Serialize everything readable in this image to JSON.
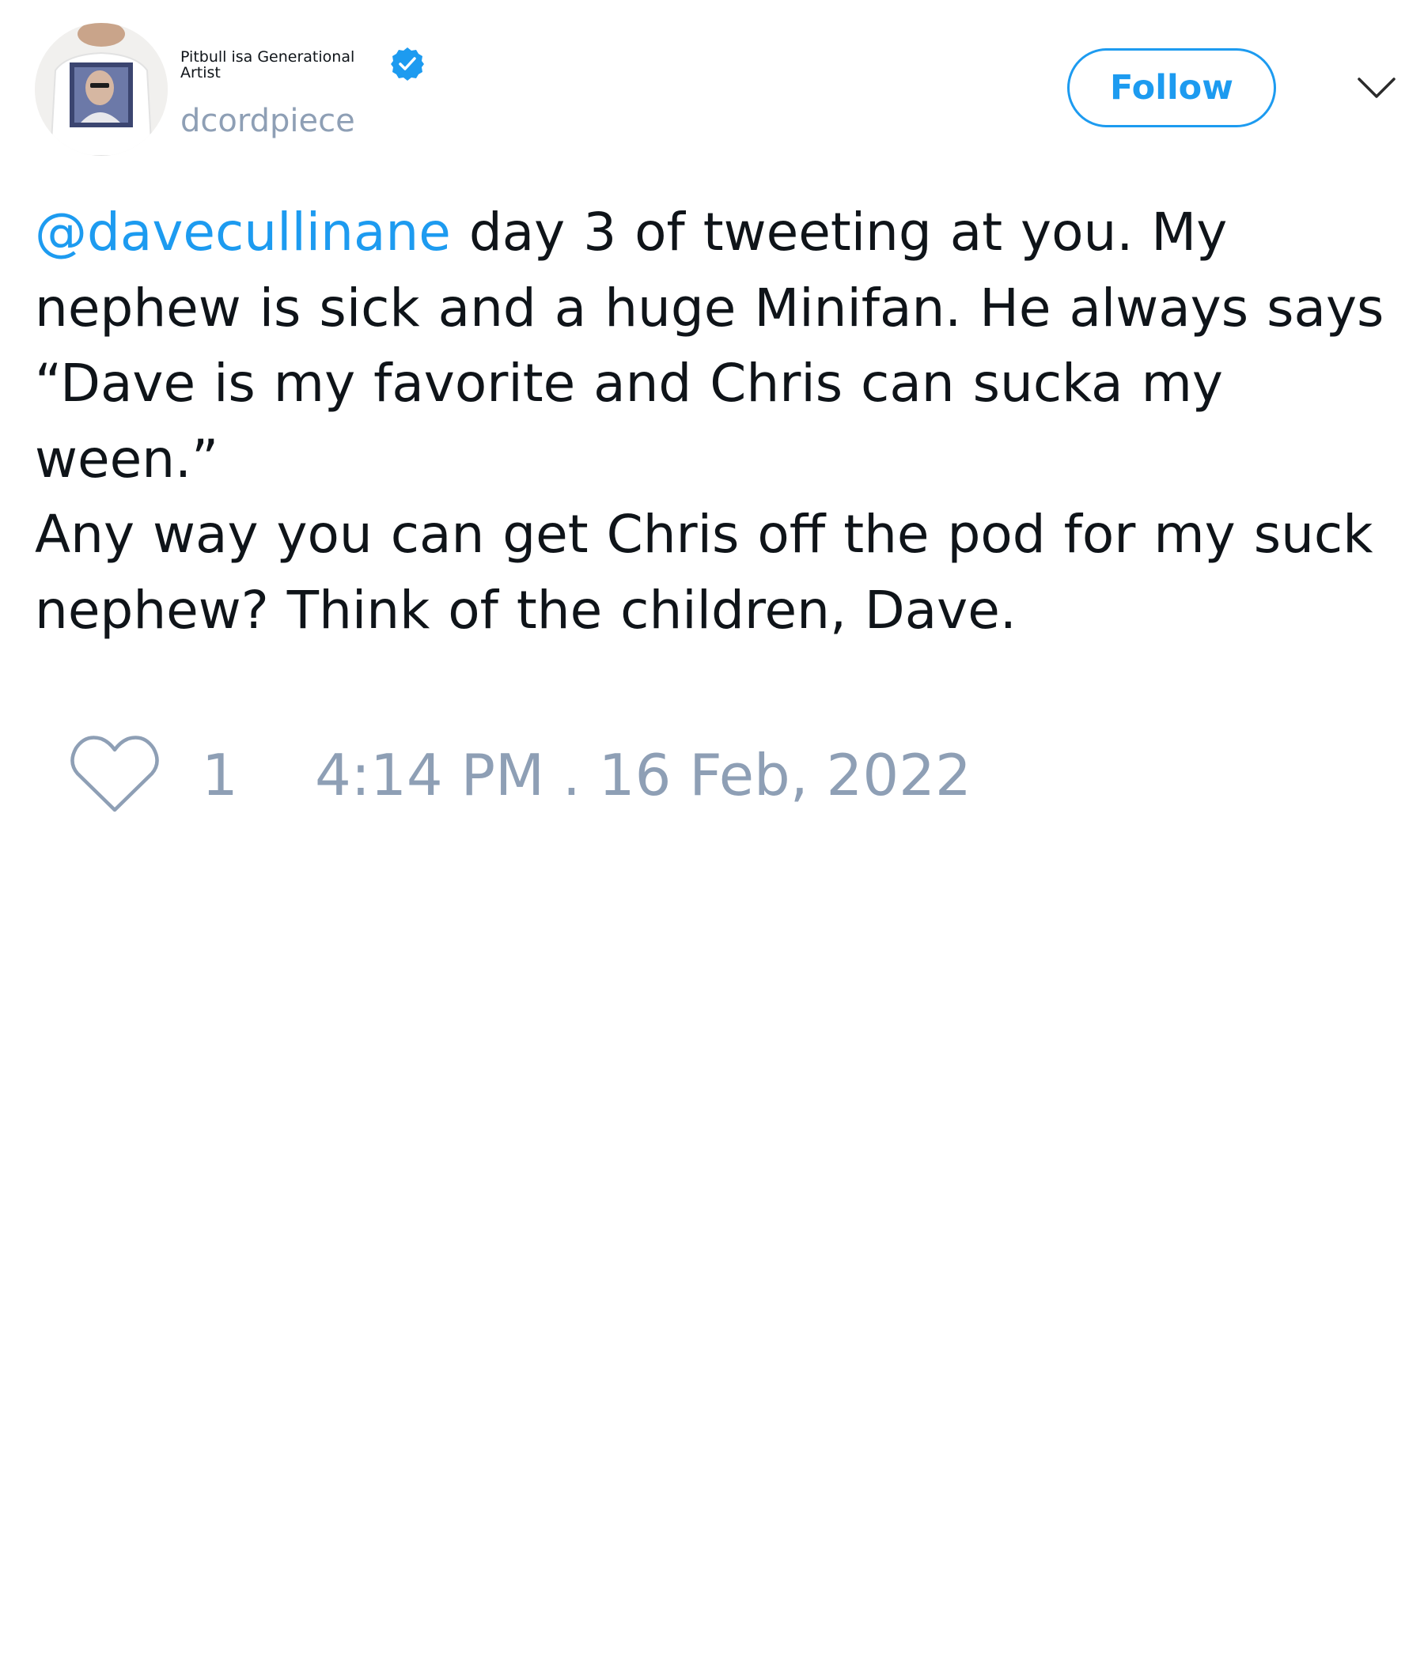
{
  "author": {
    "display_name": "Pitbull isa Generational Artist",
    "handle": "dcordpiece",
    "verified": true,
    "avatar_icon": "avatar-photo"
  },
  "actions": {
    "follow_label": "Follow",
    "menu_icon": "chevron-down-icon"
  },
  "tweet": {
    "mention": "@davecullinane",
    "text": " day 3 of tweeting at you. My nephew is sick and a huge Minifan. He always says “Dave is my favorite and Chris can sucka my ween.”\nAny way you can get Chris off the pod for my suck nephew? Think of the children, Dave."
  },
  "footer": {
    "like_icon": "heart-icon",
    "like_count": "1",
    "timestamp": "4:14 PM . 16 Feb, 2022"
  },
  "colors": {
    "accent": "#1d9bf0",
    "muted": "#8e9fb5",
    "text": "#0f1419"
  }
}
